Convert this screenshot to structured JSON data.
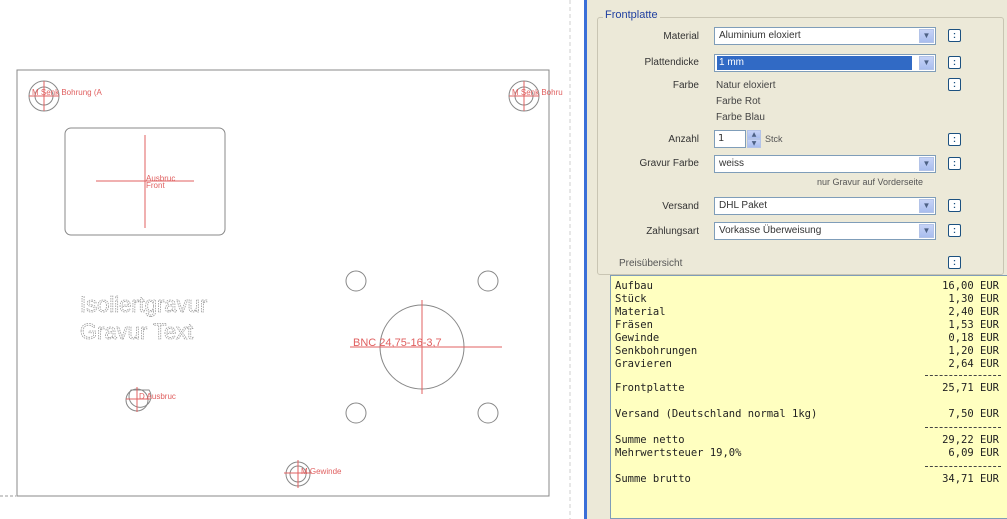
{
  "canvas": {
    "labels": {
      "senk_left": "M Senk Bohrung (A",
      "senk_right": "M Senk Bohru",
      "ausbruch_rect": "Ausbruc",
      "ausbruch_rect_sub": "Front",
      "engraving_line1": "Isoliertgravur",
      "engraving_line2": "Gravur Text",
      "bnc": "BNC 24,75-16-3,7",
      "d_ausbruch": "D Ausbruc",
      "gewinde": "M Gewinde"
    }
  },
  "panel": {
    "group_title": "Frontplatte",
    "rows": {
      "material": {
        "label": "Material",
        "value": "Aluminium eloxiert"
      },
      "thickness": {
        "label": "Plattendicke",
        "value": "1 mm"
      },
      "color": {
        "label": "Farbe",
        "options": [
          "Natur eloxiert",
          "Farbe Rot",
          "Farbe Blau"
        ]
      },
      "count": {
        "label": "Anzahl",
        "value": "1",
        "unit": "Stck"
      },
      "engraving": {
        "label": "Gravur Farbe",
        "value": "weiss",
        "note": "nur Gravur auf Vorderseite"
      },
      "versand": {
        "label": "Versand",
        "value": "DHL Paket"
      },
      "zahlung": {
        "label": "Zahlungsart",
        "value": "Vorkasse Überweisung"
      },
      "preis": {
        "label": "Preisübersicht"
      }
    },
    "bill": {
      "lines": [
        {
          "name": "Aufbau",
          "value": "16,00 EUR"
        },
        {
          "name": "Stück",
          "value": "1,30 EUR"
        },
        {
          "name": "Material",
          "value": "2,40 EUR"
        },
        {
          "name": "Fräsen",
          "value": "1,53 EUR"
        },
        {
          "name": "Gewinde",
          "value": "0,18 EUR"
        },
        {
          "name": "Senkbohrungen",
          "value": "1,20 EUR"
        },
        {
          "name": "Gravieren",
          "value": "2,64 EUR"
        }
      ],
      "subtotal": {
        "name": "Frontplatte",
        "value": "25,71 EUR"
      },
      "shipping": {
        "name": "Versand (Deutschland normal 1kg)",
        "value": "7,50 EUR"
      },
      "net": {
        "name": "Summe netto",
        "value": "29,22 EUR"
      },
      "vat": {
        "name": "Mehrwertsteuer 19,0%",
        "value": "6,09 EUR"
      },
      "gross": {
        "name": "Summe brutto",
        "value": "34,71 EUR"
      }
    }
  },
  "colors": {
    "cad_line": "#888888",
    "cad_label": "#e06060",
    "selection": "#316ac5",
    "bill_bg": "#ffffc0"
  }
}
